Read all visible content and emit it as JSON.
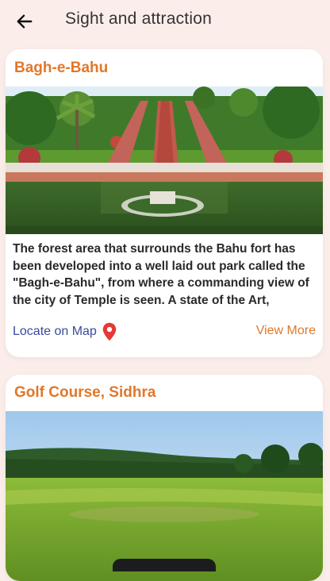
{
  "app_bar": {
    "title": "Sight and attraction",
    "back_icon": "arrow-left-icon"
  },
  "cards": [
    {
      "title": "Bagh-e-Bahu",
      "description": "The forest area that surrounds the Bahu fort has been developed into a well laid out park called the \"Bagh-e-Bahu\", from where a commanding view of the city of Temple is seen. A state of the Art,",
      "locate_label": "Locate on Map",
      "pin_icon": "map-pin-icon",
      "pin_color": "#e53935",
      "view_more_label": "View More"
    },
    {
      "title": "Golf Course, Sidhra"
    }
  ],
  "colors": {
    "accent": "#e0782a",
    "link": "#3b4a9a",
    "background": "#fbeeea"
  }
}
